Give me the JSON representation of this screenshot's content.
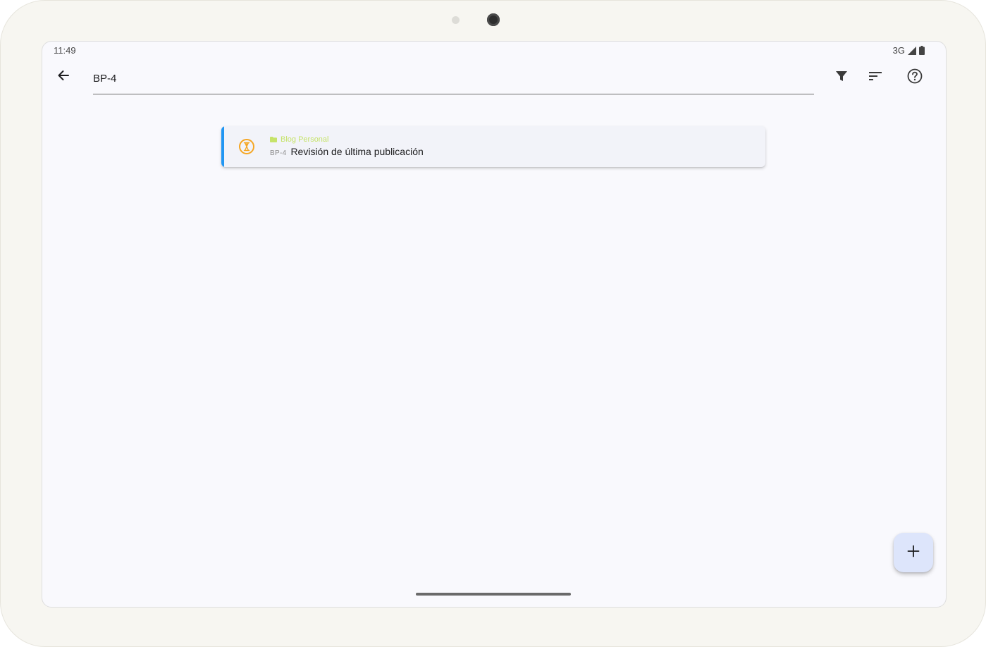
{
  "status_bar": {
    "time": "11:49",
    "network": "3G",
    "signal_icon": "cell-signal-icon",
    "battery_icon": "battery-icon"
  },
  "app_bar": {
    "back_icon": "arrow-left-icon",
    "search_value": "BP-4",
    "filter_icon": "filter-icon",
    "sort_icon": "sort-icon",
    "help_icon": "help-circle-icon"
  },
  "results": [
    {
      "project": "Blog Personal",
      "project_icon": "folder-icon",
      "key": "BP-4",
      "title": "Revisión de última publicación",
      "status_icon": "hourglass-icon",
      "accent_color": "#2196f3",
      "project_color": "#c6e36a",
      "status_color": "#f5a623"
    }
  ],
  "fab": {
    "icon": "plus-icon"
  }
}
